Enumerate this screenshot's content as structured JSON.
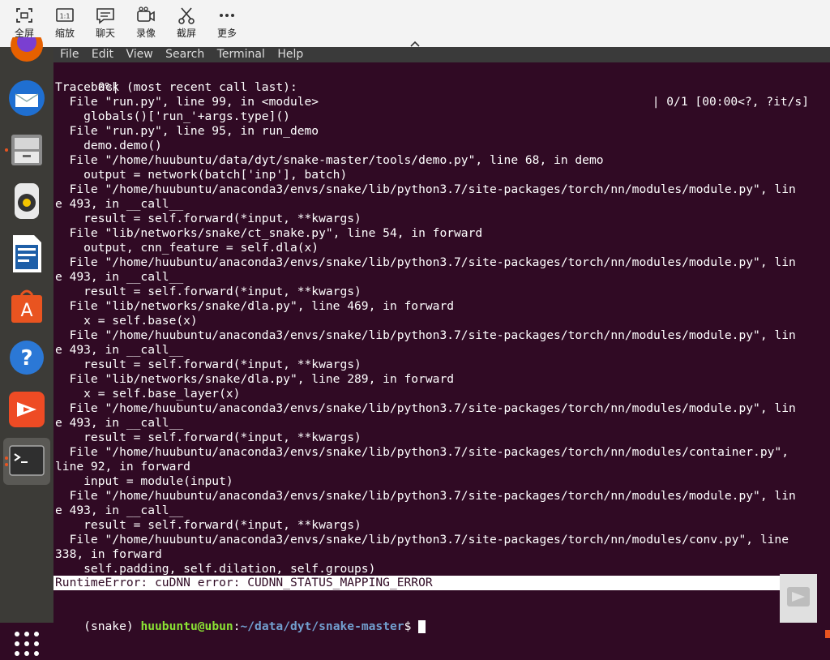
{
  "toolbar": {
    "items": [
      {
        "label": "全屏",
        "icon": "fullscreen-icon"
      },
      {
        "label": "缩放",
        "icon": "scale-icon",
        "icon_text": "1:1"
      },
      {
        "label": "聊天",
        "icon": "chat-icon"
      },
      {
        "label": "录像",
        "icon": "record-icon"
      },
      {
        "label": "截屏",
        "icon": "screenshot-icon"
      },
      {
        "label": "更多",
        "icon": "more-icon"
      }
    ]
  },
  "dock": {
    "apps": [
      "firefox-icon",
      "thunderbird-icon",
      "files-icon",
      "rhythmbox-icon",
      "writer-icon",
      "software-icon",
      "help-icon",
      "app-icon",
      "terminal-icon"
    ],
    "help_glyph": "?"
  },
  "menubar": [
    "File",
    "Edit",
    "View",
    "Search",
    "Terminal",
    "Help"
  ],
  "terminal": {
    "progress_left": "  0%|",
    "progress_right": "| 0/1 [00:00<?, ?it/s]",
    "lines": [
      "Traceback (most recent call last):",
      "  File \"run.py\", line 99, in <module>",
      "    globals()['run_'+args.type]()",
      "  File \"run.py\", line 95, in run_demo",
      "    demo.demo()",
      "  File \"/home/huubuntu/data/dyt/snake-master/tools/demo.py\", line 68, in demo",
      "    output = network(batch['inp'], batch)",
      "  File \"/home/huubuntu/anaconda3/envs/snake/lib/python3.7/site-packages/torch/nn/modules/module.py\", lin",
      "e 493, in __call__",
      "    result = self.forward(*input, **kwargs)",
      "  File \"lib/networks/snake/ct_snake.py\", line 54, in forward",
      "    output, cnn_feature = self.dla(x)",
      "  File \"/home/huubuntu/anaconda3/envs/snake/lib/python3.7/site-packages/torch/nn/modules/module.py\", lin",
      "e 493, in __call__",
      "    result = self.forward(*input, **kwargs)",
      "  File \"lib/networks/snake/dla.py\", line 469, in forward",
      "    x = self.base(x)",
      "  File \"/home/huubuntu/anaconda3/envs/snake/lib/python3.7/site-packages/torch/nn/modules/module.py\", lin",
      "e 493, in __call__",
      "    result = self.forward(*input, **kwargs)",
      "  File \"lib/networks/snake/dla.py\", line 289, in forward",
      "    x = self.base_layer(x)",
      "  File \"/home/huubuntu/anaconda3/envs/snake/lib/python3.7/site-packages/torch/nn/modules/module.py\", lin",
      "e 493, in __call__",
      "    result = self.forward(*input, **kwargs)",
      "  File \"/home/huubuntu/anaconda3/envs/snake/lib/python3.7/site-packages/torch/nn/modules/container.py\",",
      "line 92, in forward",
      "    input = module(input)",
      "  File \"/home/huubuntu/anaconda3/envs/snake/lib/python3.7/site-packages/torch/nn/modules/module.py\", lin",
      "e 493, in __call__",
      "    result = self.forward(*input, **kwargs)",
      "  File \"/home/huubuntu/anaconda3/envs/snake/lib/python3.7/site-packages/torch/nn/modules/conv.py\", line",
      "338, in forward",
      "    self.padding, self.dilation, self.groups)"
    ],
    "error": "RuntimeError: cuDNN error: CUDNN_STATUS_MAPPING_ERROR",
    "prompt": {
      "env": "(snake) ",
      "user_host": "huubuntu@ubun",
      "sep": ":",
      "path": "~/data/dyt/snake-master",
      "symbol": "$ "
    }
  }
}
